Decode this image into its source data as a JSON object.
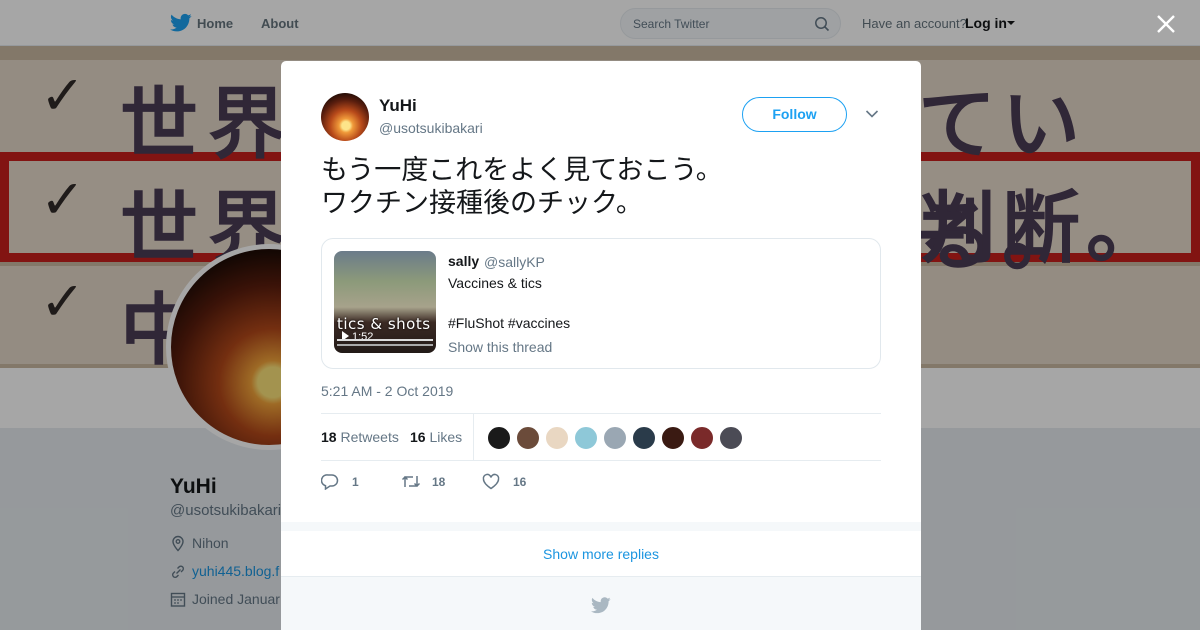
{
  "nav": {
    "home": "Home",
    "about": "About",
    "search_placeholder": "Search Twitter",
    "have_account": "Have an account?",
    "login": "Log in"
  },
  "banner": {
    "check": "✓",
    "row1_left": "世界",
    "row1_right": "ている。",
    "row2_left": "世界",
    "row2_right": "判断。",
    "row3_left": "中"
  },
  "profile": {
    "name": "YuHi",
    "handle": "@usotsukibakari",
    "location": "Nihon",
    "url": "yuhi445.blog.f",
    "joined": "Joined Januar"
  },
  "tweet": {
    "author_name": "YuHi",
    "author_handle": "@usotsukibakari",
    "follow_label": "Follow",
    "text_lines": [
      "もう一度これをよく見ておこう。",
      "ワクチン接種後のチック。"
    ],
    "timestamp": "5:21 AM - 2 Oct 2019",
    "retweets_count": "18",
    "retweets_label": "Retweets",
    "likes_count": "16",
    "likes_label": "Likes",
    "reply_count": "1",
    "retweet_count": "18",
    "like_count": "16"
  },
  "quoted": {
    "name": "sally",
    "handle": "@sallyKP",
    "line1": "Vaccines & tics",
    "line2": "#FluShot #vaccines",
    "show_thread": "Show this thread",
    "thumb_caption": "tics & shots",
    "thumb_time": "1:52"
  },
  "likers_colors": [
    "#1a1a1a",
    "#6b4b3a",
    "#e9d7c2",
    "#8ec8d8",
    "#9aa7b3",
    "#2a3b4a",
    "#3a1a12",
    "#7a2a2a",
    "#4b4b55"
  ],
  "replies": {
    "show_more": "Show more replies"
  },
  "colors": {
    "accent": "#1da1f2",
    "link": "#1b95e0",
    "muted": "#657786"
  }
}
